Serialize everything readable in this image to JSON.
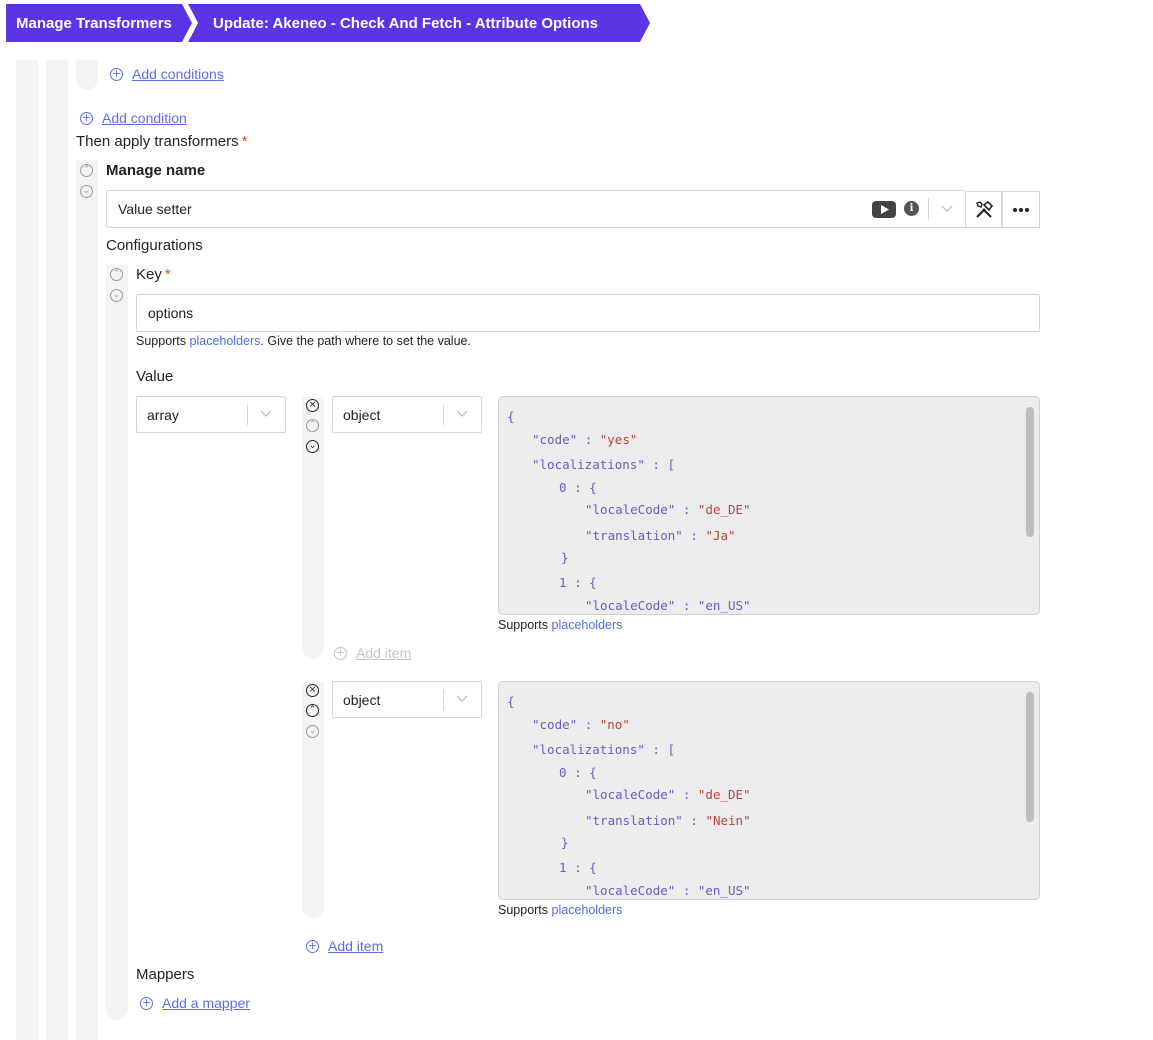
{
  "breadcrumb": {
    "root": "Manage Transformers",
    "current": "Update: Akeneo - Check And Fetch - Attribute Options"
  },
  "conditions": {
    "add_conditions": "Add conditions",
    "add_condition": "Add condition"
  },
  "transformers": {
    "heading": "Then apply transformers",
    "required_mark": "*",
    "name": "Manage name",
    "type_value": "Value setter",
    "configurations": "Configurations",
    "key_label": "Key",
    "key_value": "options",
    "key_help_pre": "Supports",
    "key_help_link": "placeholders",
    "key_help_post": ". Give the path where to set the value.",
    "value_label": "Value",
    "value_type": "array",
    "items": [
      {
        "type": "object",
        "code_value": "\"yes\"",
        "locale_code": "\"de_DE\"",
        "translation": "\"Ja\"",
        "cut_line": "\"localeCode\" : \"en_US\""
      },
      {
        "type": "object",
        "code_value": "\"no\"",
        "locale_code": "\"de_DE\"",
        "translation": "\"Nein\"",
        "cut_line": "\"localeCode\" : \"en_US\""
      }
    ],
    "code": {
      "open_brace": "{",
      "code_key": "\"code\"",
      "localizations_key": "\"localizations\"",
      "colon": ":",
      "open_bracket": "[",
      "index0": "0",
      "index1": "1",
      "close_brace": "}",
      "locale_code_key": "\"localeCode\"",
      "translation_key": "\"translation\""
    },
    "supports": "Supports",
    "placeholders": "placeholders",
    "add_item": "Add item",
    "mappers": "Mappers",
    "add_mapper": "Add a mapper"
  },
  "icons": {
    "youtube": "youtube-icon",
    "info": "info-icon",
    "tools": "tools-icon",
    "more": "more-icon"
  },
  "colors": {
    "brand": "#5b35e3",
    "link": "#5b6ee6",
    "required": "#d94a2b"
  }
}
